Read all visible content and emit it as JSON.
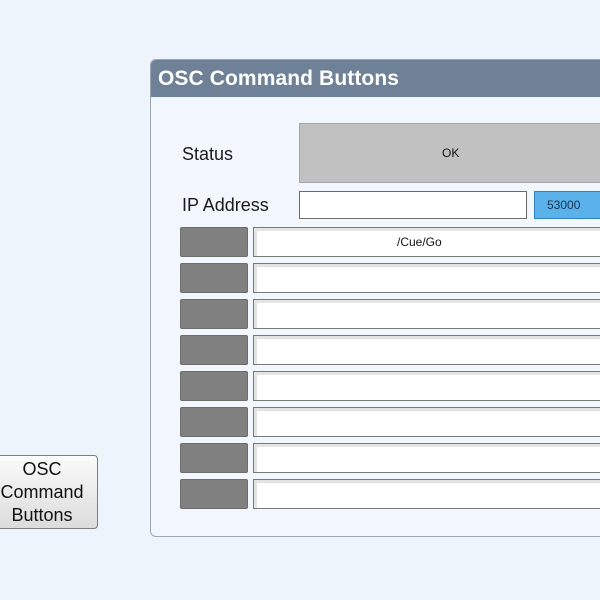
{
  "launcher": {
    "label": "OSC\nCommand\nButtons"
  },
  "panel": {
    "title": "OSC Command Buttons",
    "status_label": "Status",
    "status_value": "OK",
    "ip_label": "IP Address",
    "ip_value": "",
    "port_value": "53000",
    "commands": [
      {
        "value": "/Cue/Go"
      },
      {
        "value": ""
      },
      {
        "value": ""
      },
      {
        "value": ""
      },
      {
        "value": ""
      },
      {
        "value": ""
      },
      {
        "value": ""
      },
      {
        "value": ""
      }
    ]
  },
  "colors": {
    "header": "#6e8196",
    "port_accent": "#5bb1ea",
    "status_bg": "#c1c1c1"
  }
}
